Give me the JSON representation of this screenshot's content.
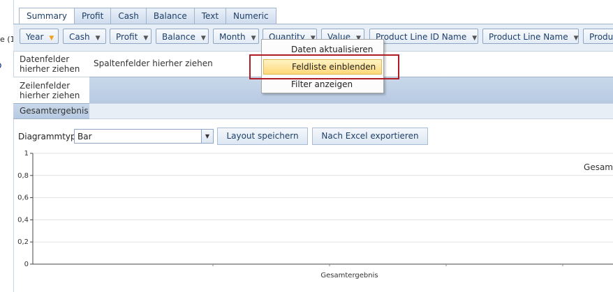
{
  "left_clipped_text": "e (1",
  "left_clipped_glyph": "o",
  "tabs": [
    "Summary",
    "Profit",
    "Cash",
    "Balance",
    "Text",
    "Numeric"
  ],
  "active_tab": "Summary",
  "filter_fields": [
    "Year",
    "Cash",
    "Profit",
    "Balance",
    "Month",
    "Quantity",
    "Value",
    "Product Line ID Name",
    "Product Line Name",
    "Produc"
  ],
  "pivot": {
    "data_drop": [
      "Datenfelder",
      "hierher ziehen"
    ],
    "column_drop": "Spaltenfelder hierher ziehen",
    "row_drop": [
      "Zeilenfelder",
      "hierher ziehen"
    ],
    "column_grand_total": "Gesam",
    "row_grand_total": "Gesamtergebnis"
  },
  "chart_toolbar": {
    "type_label": "Diagrammtyp",
    "type_value": "Bar",
    "save_layout": "Layout speichern",
    "export_excel": "Nach Excel exportieren"
  },
  "context_menu": {
    "items": [
      "Daten aktualisieren",
      "Feldliste einblenden",
      "Filter anzeigen"
    ],
    "hovered": "Feldliste einblenden"
  },
  "chart_data": {
    "type": "bar",
    "categories": [
      "Gesamtergebnis"
    ],
    "values": [],
    "yticks": [
      "0",
      "0,2",
      "0,4",
      "0,6",
      "0,8",
      "1"
    ],
    "ylim": [
      0,
      1
    ]
  }
}
